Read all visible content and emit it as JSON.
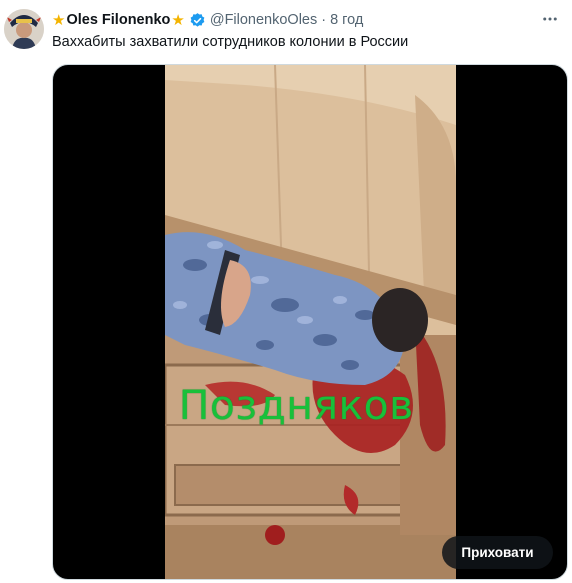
{
  "tweet": {
    "author_name": "Oles Filonenko",
    "name_prefix_emoji": "★",
    "name_suffix_emoji": "★",
    "verified_icon": "verified-badge-icon",
    "handle": "@FilonenkoOles",
    "separator": "·",
    "time": "8 год",
    "more_icon": "more-horizontal-icon",
    "text": "Ваххабиты захватили сотрудников колонии в России"
  },
  "media": {
    "overlay_caption": "Поздняков",
    "hide_button_label": "Приховати"
  },
  "colors": {
    "verified_blue": "#1d9bf0",
    "overlay_green": "#18c03a",
    "star_gold": "#f4b400"
  }
}
